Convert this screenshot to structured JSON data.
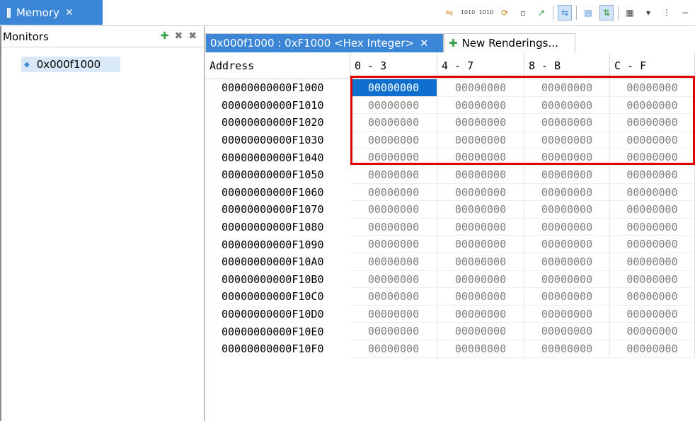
{
  "view": {
    "title": "Memory",
    "close": "✕"
  },
  "toolbar": {
    "icons": [
      "link-icon",
      "hex-1010-icon",
      "hex-1010b-icon",
      "refresh-icon",
      "new-icon",
      "export-icon",
      "sync-icon",
      "copy-icon",
      "toggle-icon",
      "columns-icon",
      "dropdown-icon",
      "more-icon"
    ]
  },
  "monitors": {
    "title": "Monitors",
    "items": [
      {
        "label": "0x000f1000"
      }
    ]
  },
  "renderings": {
    "active_tab": "0x000f1000 : 0xF1000 <Hex Integer>",
    "close": "✕",
    "new_tab": "New Renderings..."
  },
  "table": {
    "headers": [
      "Address",
      "0 - 3",
      "4 - 7",
      "8 - B",
      "C - F"
    ],
    "rows": [
      {
        "addr": "00000000000F1000",
        "c": [
          "00000000",
          "00000000",
          "00000000",
          "00000000"
        ]
      },
      {
        "addr": "00000000000F1010",
        "c": [
          "00000000",
          "00000000",
          "00000000",
          "00000000"
        ]
      },
      {
        "addr": "00000000000F1020",
        "c": [
          "00000000",
          "00000000",
          "00000000",
          "00000000"
        ]
      },
      {
        "addr": "00000000000F1030",
        "c": [
          "00000000",
          "00000000",
          "00000000",
          "00000000"
        ]
      },
      {
        "addr": "00000000000F1040",
        "c": [
          "00000000",
          "00000000",
          "00000000",
          "00000000"
        ]
      },
      {
        "addr": "00000000000F1050",
        "c": [
          "00000000",
          "00000000",
          "00000000",
          "00000000"
        ]
      },
      {
        "addr": "00000000000F1060",
        "c": [
          "00000000",
          "00000000",
          "00000000",
          "00000000"
        ]
      },
      {
        "addr": "00000000000F1070",
        "c": [
          "00000000",
          "00000000",
          "00000000",
          "00000000"
        ]
      },
      {
        "addr": "00000000000F1080",
        "c": [
          "00000000",
          "00000000",
          "00000000",
          "00000000"
        ]
      },
      {
        "addr": "00000000000F1090",
        "c": [
          "00000000",
          "00000000",
          "00000000",
          "00000000"
        ]
      },
      {
        "addr": "00000000000F10A0",
        "c": [
          "00000000",
          "00000000",
          "00000000",
          "00000000"
        ]
      },
      {
        "addr": "00000000000F10B0",
        "c": [
          "00000000",
          "00000000",
          "00000000",
          "00000000"
        ]
      },
      {
        "addr": "00000000000F10C0",
        "c": [
          "00000000",
          "00000000",
          "00000000",
          "00000000"
        ]
      },
      {
        "addr": "00000000000F10D0",
        "c": [
          "00000000",
          "00000000",
          "00000000",
          "00000000"
        ]
      },
      {
        "addr": "00000000000F10E0",
        "c": [
          "00000000",
          "00000000",
          "00000000",
          "00000000"
        ]
      },
      {
        "addr": "00000000000F10F0",
        "c": [
          "00000000",
          "00000000",
          "00000000",
          "00000000"
        ]
      }
    ],
    "selected": {
      "row": 0,
      "col": 0
    }
  },
  "colors": {
    "accent": "#3b86d6",
    "selection": "#0f6fcf",
    "annotation": "#e00000"
  }
}
